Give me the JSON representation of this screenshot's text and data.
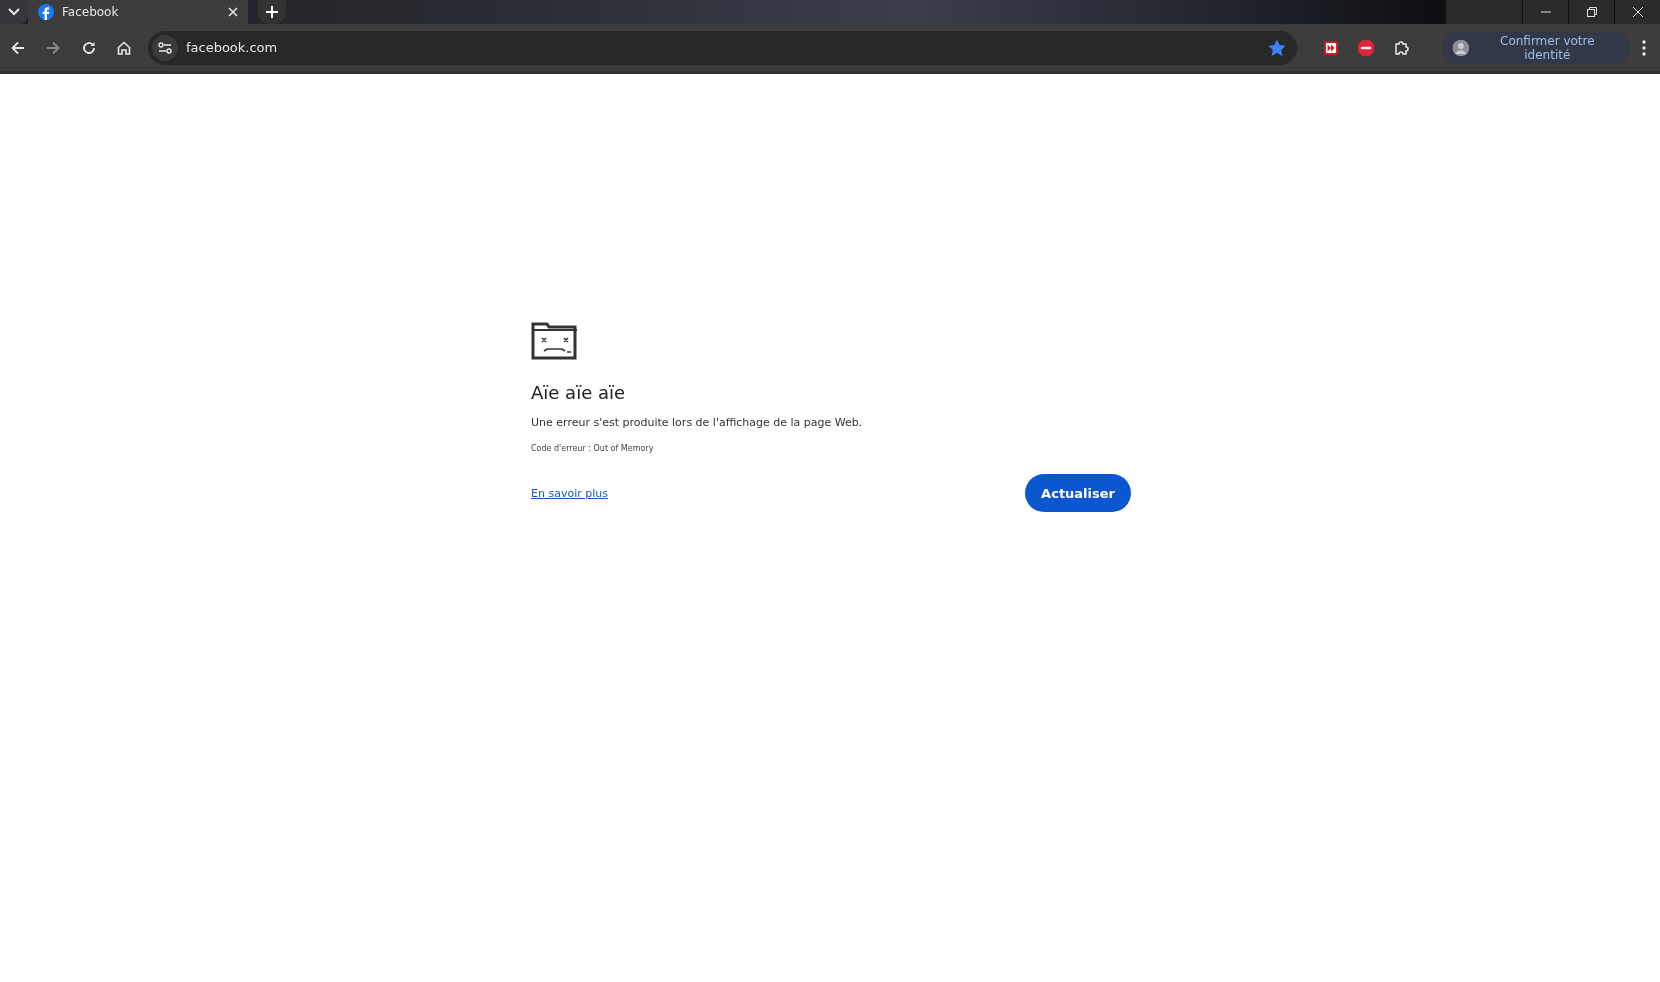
{
  "tabs": [
    {
      "title": "Facebook",
      "selected": true
    }
  ],
  "toolbar": {
    "url": "facebook.com",
    "bookmarked": true,
    "profile_label": "Confirmer votre identité"
  },
  "error": {
    "title": "Aïe aïe aïe",
    "message": "Une erreur s'est produite lors de l'affichage de la page Web.",
    "code": "Code d'erreur : Out of Memory",
    "link": "En savoir plus",
    "button": "Actualiser"
  }
}
